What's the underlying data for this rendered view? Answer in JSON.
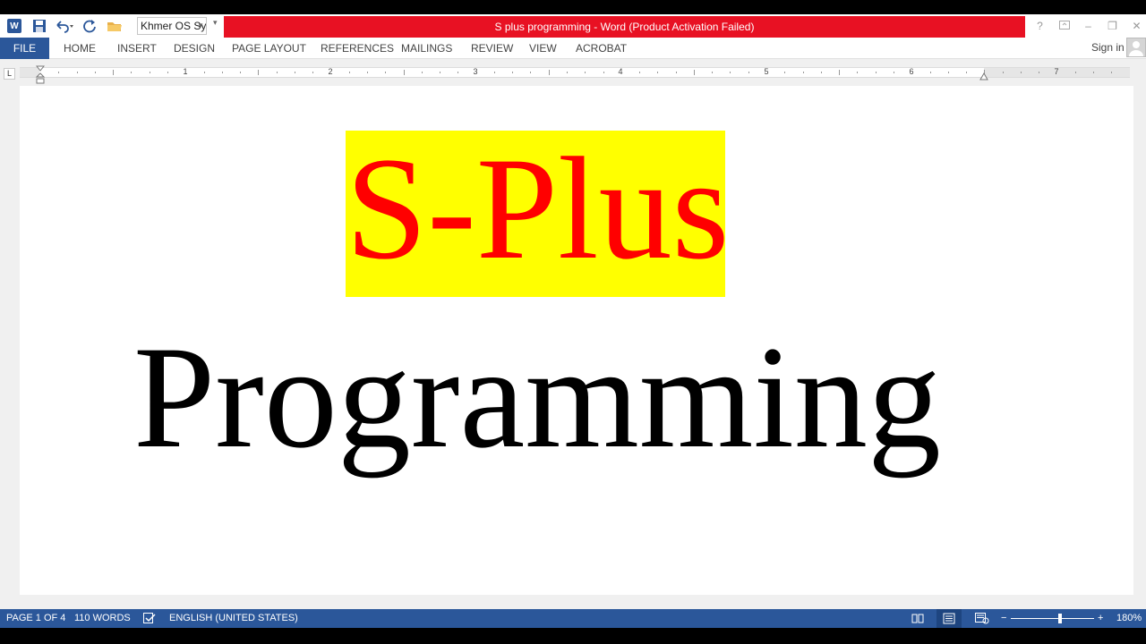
{
  "titlebar": {
    "title": "S plus programming -  Word (Product Activation Failed)",
    "font_name": "Khmer OS Sy",
    "help": "?",
    "minimize": "–",
    "restore": "❐",
    "close": "✕"
  },
  "ribbon": {
    "file": "FILE",
    "tabs": [
      "HOME",
      "INSERT",
      "DESIGN",
      "PAGE LAYOUT",
      "REFERENCES",
      "MAILINGS",
      "REVIEW",
      "VIEW",
      "ACROBAT"
    ],
    "signin": "Sign in"
  },
  "ruler": {
    "selector": "L",
    "numbers": [
      "1",
      "2",
      "3",
      "4",
      "5",
      "6",
      "7"
    ]
  },
  "document": {
    "line1": "S-Plus",
    "line2": "Programming"
  },
  "status": {
    "page": "PAGE 1 OF 4",
    "words": "110 WORDS",
    "language": "ENGLISH (UNITED STATES)",
    "zoom": "180%",
    "zoom_minus": "−",
    "zoom_plus": "+"
  },
  "colors": {
    "accent": "#2b579a",
    "activation_red": "#e81123",
    "highlight": "#ffff00",
    "text_red": "#ff0000"
  }
}
